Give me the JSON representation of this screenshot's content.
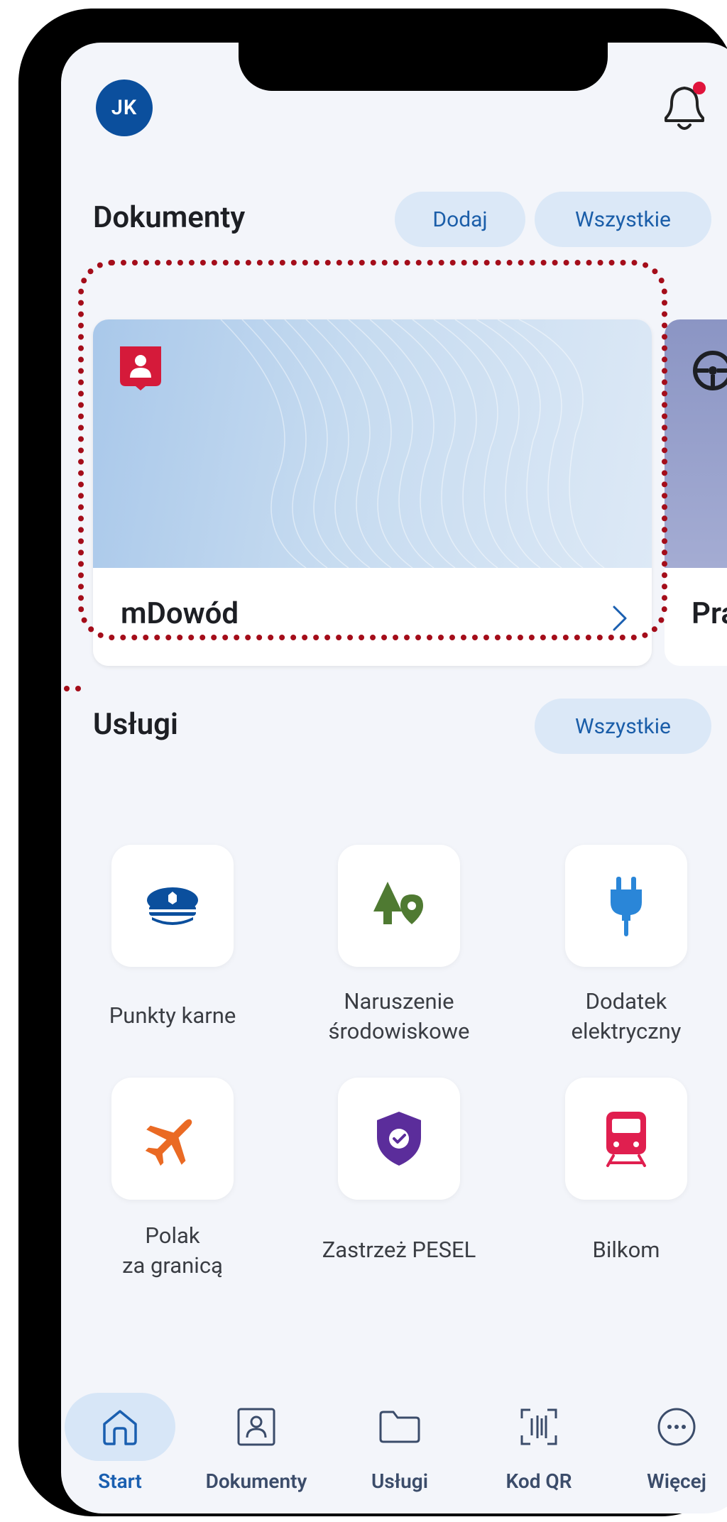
{
  "header": {
    "avatar_initials": "JK"
  },
  "documents": {
    "title": "Dokumenty",
    "add_label": "Dodaj",
    "all_label": "Wszystkie",
    "cards": [
      {
        "name": "mDowód",
        "icon": "id-card-icon"
      },
      {
        "name": "Pra",
        "icon": "steering-wheel-icon"
      }
    ]
  },
  "services": {
    "title": "Usługi",
    "all_label": "Wszystkie",
    "items": [
      {
        "label": "Punkty karne",
        "icon": "police-cap-icon"
      },
      {
        "label": "Naruszenie\nśrodowiskowe",
        "icon": "tree-location-icon"
      },
      {
        "label": "Dodatek\nelektryczny",
        "icon": "plug-icon"
      },
      {
        "label": "Polak\nza granicą",
        "icon": "airplane-icon"
      },
      {
        "label": "Zastrzeż PESEL",
        "icon": "shield-check-icon"
      },
      {
        "label": "Bilkom",
        "icon": "train-icon"
      }
    ]
  },
  "tabbar": {
    "tabs": [
      {
        "label": "Start",
        "active": true,
        "icon": "home-icon"
      },
      {
        "label": "Dokumenty",
        "active": false,
        "icon": "document-person-icon"
      },
      {
        "label": "Usługi",
        "active": false,
        "icon": "folder-icon"
      },
      {
        "label": "Kod QR",
        "active": false,
        "icon": "qr-scan-icon"
      },
      {
        "label": "Więcej",
        "active": false,
        "icon": "more-icon"
      }
    ]
  },
  "colors": {
    "primary": "#1a5fb0",
    "avatar_bg": "#0b4f9d",
    "highlight_dots": "#a40d1a",
    "notification_dot": "#e0143c"
  }
}
